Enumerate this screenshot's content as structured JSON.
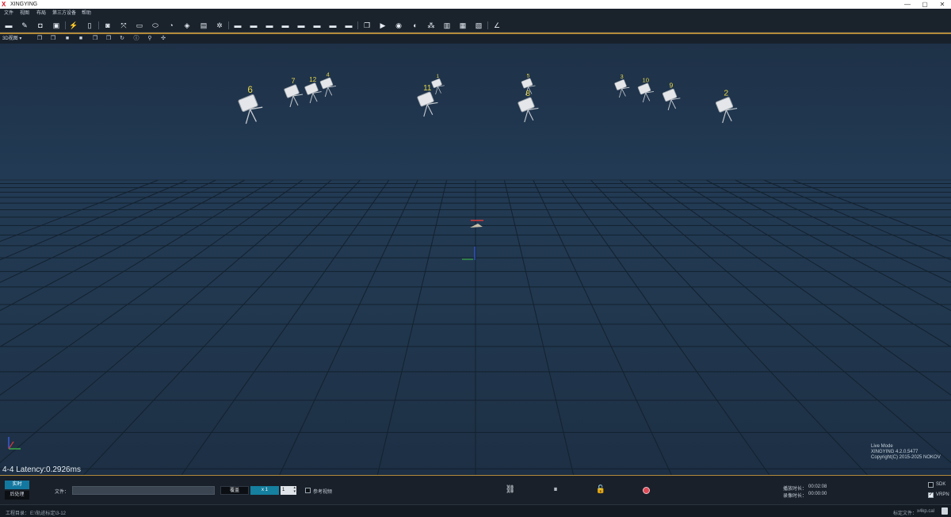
{
  "window": {
    "title": "XINGYING",
    "logo": "X",
    "controls": {
      "minimize": "—",
      "maximize": "▢",
      "close": "✕"
    }
  },
  "menu": {
    "items": [
      "文件",
      "视图",
      "布局",
      "第三方设备",
      "帮助"
    ]
  },
  "toolbar": {
    "icons": [
      "folder-open-icon",
      "edit-icon",
      "device-icon",
      "save-icon",
      "link-off-icon",
      "camera-door-icon",
      "camera-icon",
      "expand-icon",
      "bar-icon",
      "ellipse-icon",
      "refresh-circle-icon",
      "layers-icon",
      "monitor-icon",
      "settings-gear-icon",
      "screen-icon",
      "screen-icon",
      "screen-icon",
      "screen-icon",
      "screen-icon",
      "screen-icon",
      "screen-icon",
      "screen-icon",
      "copy-icon",
      "video-icon",
      "disc-icon",
      "gauge-icon",
      "node-graph-icon",
      "bar-chart-icon",
      "tile-icon",
      "document-icon",
      "axis-icon"
    ]
  },
  "viewbar": {
    "view_select": "3D视图"
  },
  "viewport": {
    "latency": "4-4 Latency:0.2926ms",
    "live_mode": "Live Mode",
    "version": "XINGYING 4.2.0.5477",
    "copyright": "Copyright(C) 2015-2025 NOKOV",
    "cameras": [
      {
        "label": "6"
      },
      {
        "label": "7"
      },
      {
        "label": "12"
      },
      {
        "label": "4"
      },
      {
        "label": "11"
      },
      {
        "label": "1"
      },
      {
        "label": "5"
      },
      {
        "label": "8"
      },
      {
        "label": "3"
      },
      {
        "label": "10"
      },
      {
        "label": "9"
      },
      {
        "label": "2"
      }
    ]
  },
  "bottom": {
    "realtime_button": "实时",
    "post_button": "后处理",
    "file_label": "文件：",
    "file_value": "",
    "browse_button": "覆盖",
    "speed_button": "x 1",
    "stepper_value": "1",
    "ref_video_label": "参考视频",
    "play_time_label": "播放时长：",
    "play_time_value": "00:02:08",
    "record_time_label": "录像时长：",
    "record_time_value": "00:00:00",
    "sdk_label": "SDK",
    "vrpn_label": "VRPN",
    "sdk_checked": false,
    "vrpn_checked": true
  },
  "status": {
    "project_label": "工程目录：",
    "project_path": "E:\\轨迹标定\\3-12",
    "calib_label": "标定文件：",
    "calib_file": "x4kp.cal"
  }
}
